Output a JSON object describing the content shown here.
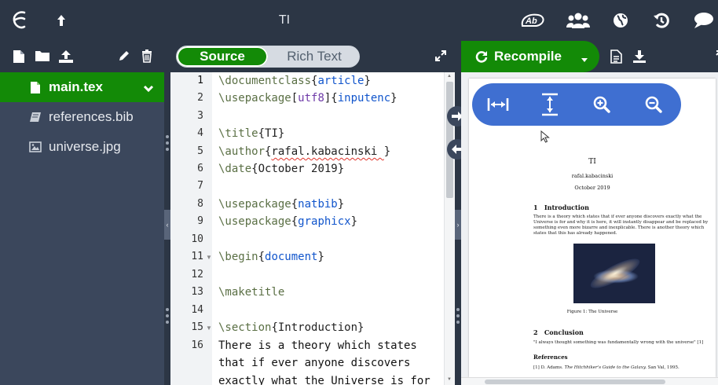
{
  "app": {
    "title": "TI"
  },
  "topbar": {
    "logo_icon": "overleaf-leaf-icon",
    "icons": [
      "menu-icon",
      "up-arrow-icon",
      "spell-check-icon",
      "share-users-icon",
      "globe-icon",
      "history-icon",
      "chat-icon"
    ]
  },
  "colors": {
    "topbar": "#2c3645",
    "sidebar": "#3b475c",
    "accent_green": "#138a07",
    "pdf_controls": "#3f6fd1"
  },
  "file_tree": {
    "items": [
      {
        "label": "main.tex",
        "icon": "file-icon",
        "selected": true
      },
      {
        "label": "references.bib",
        "icon": "book-icon",
        "selected": false
      },
      {
        "label": "universe.jpg",
        "icon": "image-icon",
        "selected": false
      }
    ]
  },
  "editor": {
    "mode_source": "Source",
    "mode_rich": "Rich Text",
    "line_numbers": [
      "1",
      "2",
      "3",
      "4",
      "5",
      "6",
      "7",
      "8",
      "9",
      "10",
      "11",
      "12",
      "13",
      "14",
      "15",
      "16"
    ],
    "lines": {
      "l1_cmd": "\\documentclass",
      "l1_arg": "article",
      "l2_cmd": "\\usepackage",
      "l2_opt": "utf8",
      "l2_arg": "inputenc",
      "l4_cmd": "\\title",
      "l4_arg": "TI",
      "l5_cmd": "\\author",
      "l5_arg": "rafal.kabacinski ",
      "l6_cmd": "\\date",
      "l6_arg": "October 2019",
      "l8_cmd": "\\usepackage",
      "l8_arg": "natbib",
      "l9_cmd": "\\usepackage",
      "l9_arg": "graphicx",
      "l11_cmd": "\\begin",
      "l11_arg": "document",
      "l13_cmd": "\\maketitle",
      "l15_cmd": "\\section",
      "l15_arg": "Introduction",
      "l16_text": "There is a theory which states",
      "l16_cont1": "that if ever anyone discovers",
      "l16_cont2": "exactly what the Universe is for"
    }
  },
  "pdf_toolbar": {
    "recompile_label": "Recompile"
  },
  "pdf": {
    "title": "TI",
    "author": "rafal.kabacinski",
    "date": "October 2019",
    "section1": "1   Introduction",
    "body1_l1": "There is a theory which states that if ever anyone discovers exactly what the",
    "body1_l2": "Universe is for and why it is here, it will instantly disappear and be replaced by",
    "body1_l3": "something even more bizarre and inexplicable.  There is another theory which",
    "body1_l4": "states that this has already happened.",
    "figure_caption": "Figure 1: The Universe",
    "section2": "2   Conclusion",
    "body2": "\"I always thought something was fundamentally wrong with the universe\" [1]",
    "references_heading": "References",
    "ref1_prefix": "[1] D. Adams. ",
    "ref1_title": "The Hitchhiker's Guide to the Galaxy.",
    "ref1_suffix": " San Val, 1995."
  }
}
